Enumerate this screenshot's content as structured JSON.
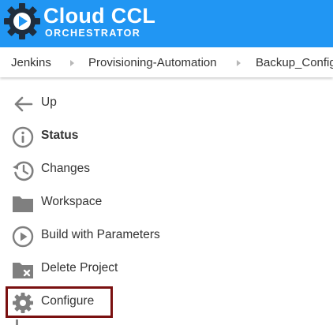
{
  "header": {
    "title": "Cloud CCL",
    "subtitle": "ORCHESTRATOR",
    "logo_icon": "gear-play-icon",
    "background": "#2196f3"
  },
  "breadcrumb": {
    "items": [
      "Jenkins",
      "Provisioning-Automation",
      "Backup_Config"
    ]
  },
  "menu": {
    "items": [
      {
        "label": "Up",
        "icon": "arrow-left-icon"
      },
      {
        "label": "Status",
        "icon": "info-icon"
      },
      {
        "label": "Changes",
        "icon": "history-icon"
      },
      {
        "label": "Workspace",
        "icon": "folder-icon"
      },
      {
        "label": "Build with Parameters",
        "icon": "play-circle-icon"
      },
      {
        "label": "Delete Project",
        "icon": "folder-delete-icon"
      },
      {
        "label": "Configure",
        "icon": "gear-icon"
      }
    ],
    "highlight_color": "#7a1010"
  }
}
